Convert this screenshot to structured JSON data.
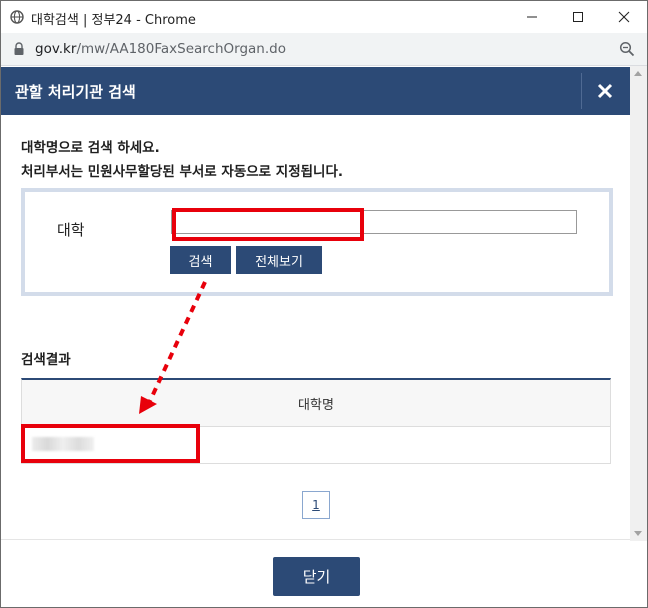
{
  "window": {
    "title": "대학검색 | 정부24 - Chrome"
  },
  "address": {
    "host": "gov.kr",
    "path": "/mw/AA180FaxSearchOrgan.do"
  },
  "popup": {
    "title": "관할 처리기관 검색",
    "intro_line1": "대학명으로 검색 하세요.",
    "intro_line2": "처리부서는 민원사무할당된 부서로 자동으로 지정됩니다.",
    "univ_label": "대학",
    "univ_value": "",
    "search_button": "검색",
    "view_all_button": "전체보기",
    "results_title": "검색결과",
    "table_header": "대학명",
    "page_number": "1",
    "close_button": "닫기"
  },
  "colors": {
    "header": "#2c4a76",
    "highlight": "#e8000b",
    "search_border": "#d3dcea"
  }
}
